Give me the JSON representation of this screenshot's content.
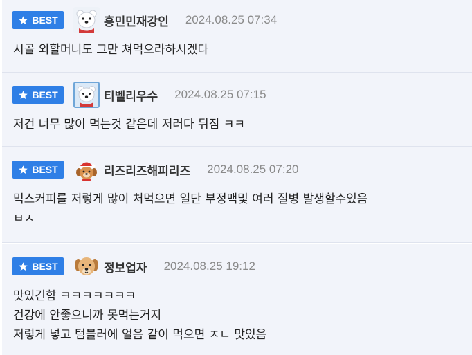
{
  "badge_label": "BEST",
  "comments": [
    {
      "nickname": "흥민민재강인",
      "timestamp": "2024.08.25 07:34",
      "avatar": "polar-bear-icon",
      "lines": [
        "시골 외할머니도 그만 쳐먹으라하시겠다"
      ]
    },
    {
      "nickname": "티벨리우수",
      "timestamp": "2024.08.25 07:15",
      "avatar": "polar-bear-icon",
      "lines": [
        "저건 너무 많이 먹는것 같은데 저러다 뒤짐 ㅋㅋ"
      ]
    },
    {
      "nickname": "리즈리즈해피리즈",
      "timestamp": "2024.08.25 07:20",
      "avatar": "puppy-santa-hat-icon",
      "lines": [
        "믹스커피를 저렇게 많이 처먹으면 일단 부정맥및 여러 질병 발생할수있음",
        "ㅂㅅ"
      ]
    },
    {
      "nickname": "정보업자",
      "timestamp": "2024.08.25 19:12",
      "avatar": "puppy-icon",
      "lines": [
        "맛있긴함 ㅋㅋㅋㅋㅋㅋㅋ",
        "건강에 안좋으니까 못먹는거지",
        "저렇게 넣고 텀블러에 얼음 같이 먹으면 ㅈㄴ 맛있음"
      ]
    }
  ],
  "colors": {
    "badge": "#2f7fe6",
    "card_bg": "#f2f4fa",
    "timestamp": "#8a8a8a"
  }
}
